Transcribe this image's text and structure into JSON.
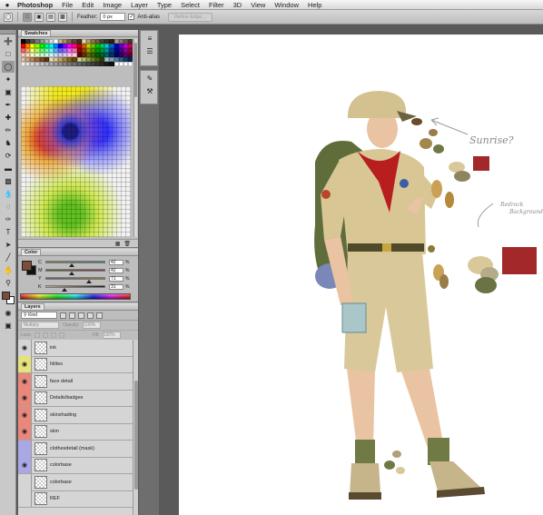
{
  "menubar": {
    "apple": "",
    "app": "Photoshop",
    "items": [
      "File",
      "Edit",
      "Image",
      "Layer",
      "Type",
      "Select",
      "Filter",
      "3D",
      "View",
      "Window",
      "Help"
    ]
  },
  "options": {
    "feather_label": "Feather:",
    "feather_value": "0 px",
    "antialias_label": "Anti-alias",
    "refine_label": "Refine Edge..."
  },
  "panels": {
    "swatches_title": "Swatches",
    "color_title": "Color",
    "layers_title": "Layers"
  },
  "color": {
    "foreground": "#7a4e3a",
    "background": "#111111",
    "channels": [
      {
        "label": "C",
        "value": "42",
        "unit": "%",
        "level": 0.42
      },
      {
        "label": "M",
        "value": "42",
        "unit": "%",
        "level": 0.42
      },
      {
        "label": "Y",
        "value": "71",
        "unit": "%",
        "level": 0.71
      },
      {
        "label": "K",
        "value": "31",
        "unit": "%",
        "level": 0.31
      }
    ]
  },
  "layers": {
    "kind_label": "Kind",
    "mode_label": "Multiply",
    "opacity_label": "Opacity:",
    "opacity_value": "100%",
    "lock_label": "Lock:",
    "fill_label": "Fill:",
    "fill_value": "100%",
    "rows": [
      {
        "name": "ink",
        "color": "#d5d5d5",
        "visible": true
      },
      {
        "name": "hilites",
        "color": "#e8e27a",
        "visible": true
      },
      {
        "name": "face detail",
        "color": "#e8877a",
        "visible": true
      },
      {
        "name": "Details/badges",
        "color": "#e8877a",
        "visible": true
      },
      {
        "name": "skinshading",
        "color": "#e8877a",
        "visible": true
      },
      {
        "name": "skin",
        "color": "#e8877a",
        "visible": true
      },
      {
        "name": "clothesdetail (mask)",
        "color": "#a9a7e4",
        "visible": false
      },
      {
        "name": "colorbase",
        "color": "#a9a7e4",
        "visible": true
      },
      {
        "name": "colorbase",
        "color": "#d5d5d5",
        "visible": false
      },
      {
        "name": "REF",
        "color": "#d5d5d5",
        "visible": false
      }
    ]
  },
  "canvas": {
    "note_sunrise": "Sunrise?",
    "note_redrock_1": "Redrock",
    "note_redrock_2": "Background"
  }
}
